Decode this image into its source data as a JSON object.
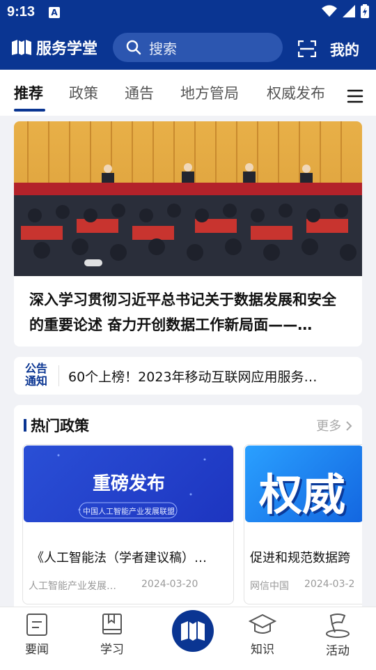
{
  "status_bar": {
    "time": "9:13",
    "app_icon": "A"
  },
  "header": {
    "logo_text": "服务学堂",
    "search_placeholder": "搜索",
    "mine": "我的"
  },
  "tabs": [
    {
      "label": "推荐",
      "active": true
    },
    {
      "label": "政策"
    },
    {
      "label": "通告"
    },
    {
      "label": "地方管局"
    },
    {
      "label": "权威发布"
    }
  ],
  "banner": {
    "title": "深入学习贯彻习近平总书记关于数据发展和安全的重要论述 奋力开创数据工作新局面——…"
  },
  "notice": {
    "logo_top": "公告",
    "logo_bottom": "通知",
    "text": "60个上榜！2023年移动互联网应用服务…"
  },
  "hot_policy": {
    "title": "热门政策",
    "more": "更多",
    "cards": [
      {
        "image_title": "重磅发布",
        "image_subtitle": "中国人工智能产业发展联盟",
        "title": "《人工智能法（学者建议稿）…",
        "source": "人工智能产业发展…",
        "date": "2024-03-20"
      },
      {
        "image_title": "权威",
        "title": "促进和规范数据跨",
        "source": "网信中国",
        "date": "2024-03-2"
      }
    ]
  },
  "bottom_nav": [
    {
      "label": "要闻",
      "icon": "news-icon"
    },
    {
      "label": "学习",
      "icon": "book-icon"
    },
    {
      "label": "",
      "icon": "center-logo-icon"
    },
    {
      "label": "知识",
      "icon": "graduation-cap-icon"
    },
    {
      "label": "活动",
      "icon": "flag-icon"
    }
  ],
  "colors": {
    "brand": "#0a3592",
    "background": "#f1f2f6"
  }
}
